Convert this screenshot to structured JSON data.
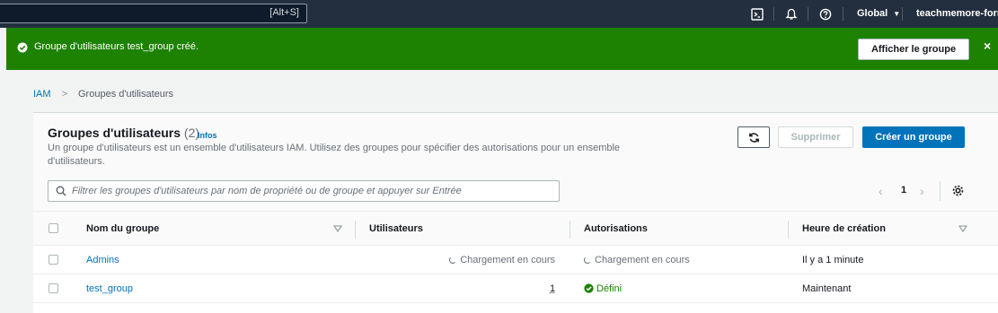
{
  "topnav": {
    "search_shortcut": "[Alt+S]",
    "icons": [
      "cloudshell-icon",
      "bell-icon",
      "help-icon",
      "dropdown-caret-icon"
    ],
    "region": "Global",
    "account": "teachmemore-forma"
  },
  "flash": {
    "message": "Groupe d'utilisateurs test_group créé.",
    "action_label": "Afficher le groupe",
    "close_symbol": "×"
  },
  "breadcrumb": {
    "root": "IAM",
    "current": "Groupes d'utilisateurs"
  },
  "header": {
    "title": "Groupes d'utilisateurs",
    "count": "(2)",
    "info": "Infos",
    "description": "Un groupe d'utilisateurs est un ensemble d'utilisateurs IAM. Utilisez des groupes pour spécifier des autorisations pour un ensemble d'utilisateurs.",
    "delete_label": "Supprimer",
    "create_label": "Créer un groupe"
  },
  "filter": {
    "placeholder": "Filtrer les groupes d'utilisateurs par nom de propriété ou de groupe et appuyer sur Entrée"
  },
  "pagination": {
    "page": "1",
    "prev": "‹",
    "next": "›"
  },
  "table": {
    "columns": [
      "Nom du groupe",
      "Utilisateurs",
      "Autorisations",
      "Heure de création"
    ],
    "rows": [
      {
        "name": "Admins",
        "users": "Chargement en cours",
        "permissions": "Chargement en cours",
        "created": "Il y a 1 minute"
      },
      {
        "name": "test_group",
        "users": "1",
        "permissions": "Défini",
        "created": "Maintenant"
      }
    ]
  },
  "colors": {
    "nav_bg": "#232f3e",
    "success": "#1d8102",
    "link": "#0073bb",
    "primary": "#0073bb"
  }
}
